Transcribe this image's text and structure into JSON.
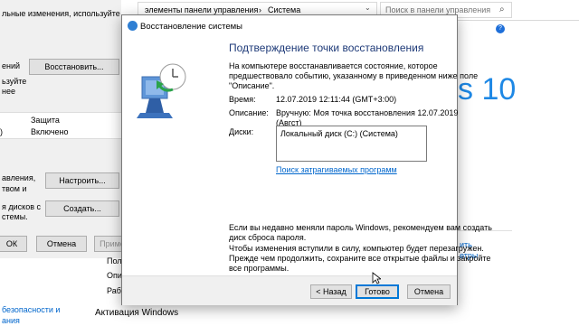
{
  "background_left": {
    "line1": "льные изменения, используйте",
    "line2": "ений",
    "restore_button": "Восстановить...",
    "line3": "ьзуйте",
    "line4": "нее",
    "table_header_col2": "Защита",
    "table_row_col1": ")",
    "table_row_value": "Включено",
    "line5": "авления,",
    "line6": "твом и",
    "configure_button": "Настроить...",
    "line7": "я дисков с",
    "line8": "стемы.",
    "create_button": "Создать...",
    "ok_button": "ОК",
    "cancel_button": "Отмена",
    "apply_button": "Приме",
    "bottom1": "безопасности и",
    "bottom2": "ания"
  },
  "control_panel": {
    "breadcrumb_part1": "элементы панели управления",
    "breadcrumb_sep": "›",
    "breadcrumb_part2": "Система",
    "search_placeholder": "Поиск в панели управления",
    "windows_10_text": "s 10",
    "label_pol": "Пол",
    "label_opi": "Опи",
    "label_rab": "Раб",
    "activation": "Активация Windows",
    "link1": "ить",
    "link2": "етры"
  },
  "dialog": {
    "title": "Восстановление системы",
    "heading": "Подтверждение точки восстановления",
    "intro": [
      "На компьютере восстанавливается состояние, которое",
      "предшествовало событию, указанному в приведенном ниже поле",
      "\"Описание\"."
    ],
    "time_label": "Время:",
    "time_value": "12.07.2019 12:11:44 (GMT+3:00)",
    "description_label": "Описание:",
    "description_value_line1": "Вручную: Моя точка восстановления 12.07.2019",
    "description_value_line2": "(Авгст)",
    "disks_label": "Диски:",
    "disks_value": "Локальный диск (C:) (Система)",
    "affected_link": "Поиск затрагиваемых программ",
    "password_note": [
      "Если вы недавно меняли пароль Windows, рекомендуем вам создать",
      "диск сброса пароля."
    ],
    "restart_note": [
      "Чтобы изменения вступили в силу, компьютер будет перезагружен.",
      "Прежде чем продолжить, сохраните все открытые файлы и закройте",
      "все программы."
    ],
    "back_button": "< Назад",
    "finish_button": "Готово",
    "cancel_button": "Отмена"
  },
  "colors": {
    "dialog_bg": "#ffffff",
    "heading_color": "#1e3a78",
    "link_color": "#0066cc",
    "accent": "#0078d7"
  }
}
